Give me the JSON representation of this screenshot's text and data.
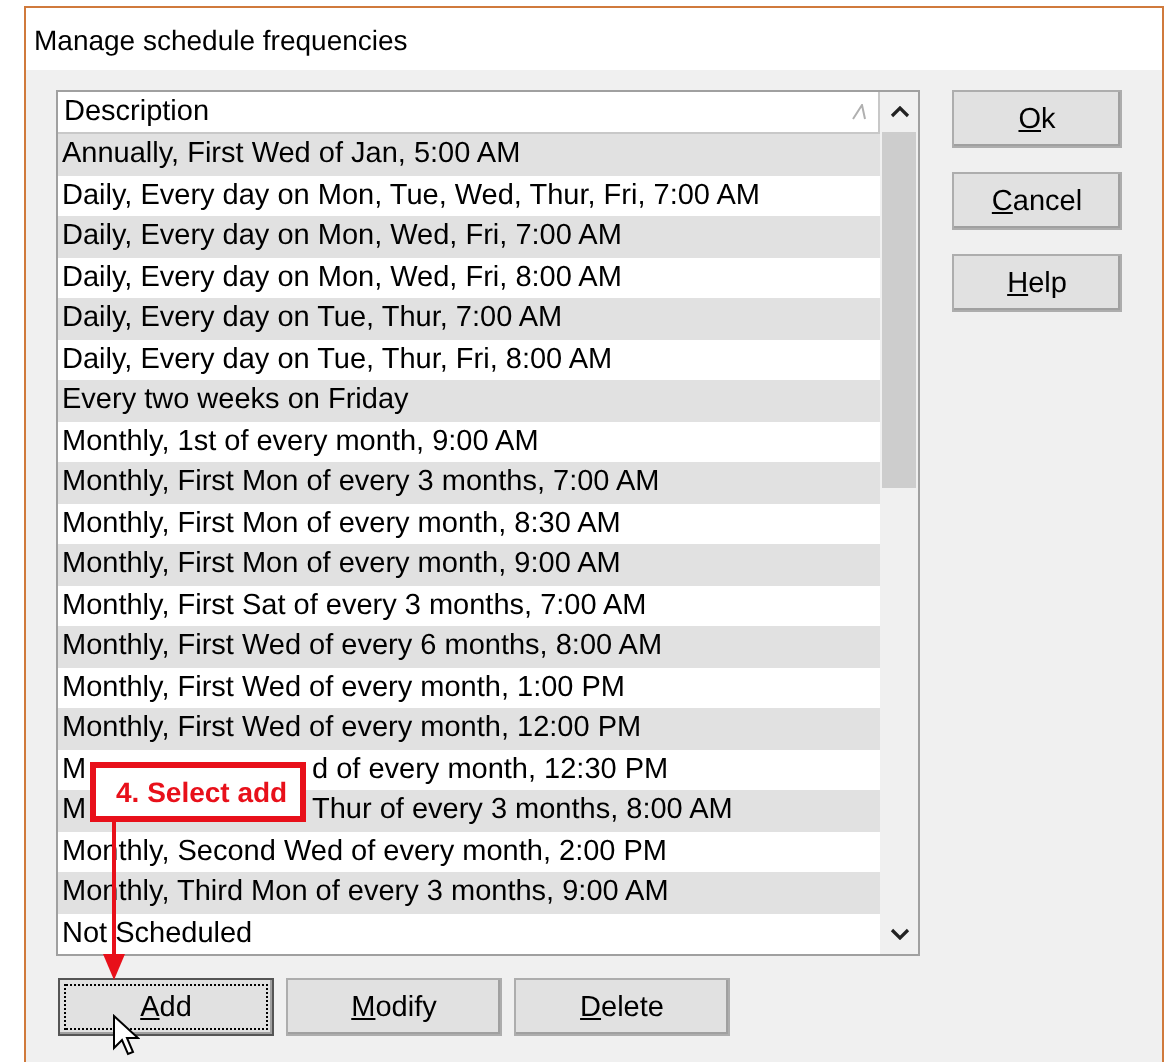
{
  "window": {
    "title": "Manage schedule frequencies"
  },
  "list": {
    "header": "Description",
    "rows": [
      {
        "parts": [
          "Annually, First Wed of Jan, 5:00 AM"
        ]
      },
      {
        "parts": [
          "Daily, Every day on Mon, Tue, Wed, Thur, Fri, 7:00 AM"
        ]
      },
      {
        "parts": [
          "Daily, Every day on Mon, Wed, Fri, 7:00 AM"
        ]
      },
      {
        "parts": [
          "Daily, Every day on Mon, Wed, Fri, 8:00 AM"
        ]
      },
      {
        "parts": [
          "Daily, Every day on Tue, Thur, 7:00 AM"
        ]
      },
      {
        "parts": [
          "Daily, Every day on Tue, Thur, Fri, 8:00 AM"
        ]
      },
      {
        "parts": [
          "Every two weeks on Friday"
        ]
      },
      {
        "parts": [
          "Monthly, 1st of every month, 9:00 AM"
        ]
      },
      {
        "parts": [
          "Monthly, First Mon of every 3 months, 7:00 AM"
        ]
      },
      {
        "parts": [
          "Monthly, First Mon of every month, 8:30 AM"
        ]
      },
      {
        "parts": [
          "Monthly, First Mon of every month, 9:00 AM"
        ]
      },
      {
        "parts": [
          "Monthly, First Sat of every 3 months, 7:00 AM"
        ]
      },
      {
        "parts": [
          "Monthly, First Wed of every 6 months, 8:00 AM"
        ]
      },
      {
        "parts": [
          "Monthly, First Wed of every month, 1:00 PM"
        ]
      },
      {
        "parts": [
          "Monthly, First Wed of every month, 12:00 PM"
        ]
      },
      {
        "parts": [
          "M",
          "d of every month, 12:30 PM"
        ]
      },
      {
        "parts": [
          "M",
          "Thur of every 3 months, 8:00 AM"
        ]
      },
      {
        "parts": [
          "Monthly, Second Wed of every month, 2:00 PM"
        ]
      },
      {
        "parts": [
          "Monthly, Third Mon of every 3 months, 9:00 AM"
        ]
      },
      {
        "parts": [
          "Not Scheduled"
        ]
      }
    ]
  },
  "side_buttons": [
    {
      "label": "Ok"
    },
    {
      "label": "Cancel"
    },
    {
      "label": "Help"
    }
  ],
  "bottom_buttons": [
    {
      "label": "Add",
      "focused": true
    },
    {
      "label": "Modify",
      "focused": false
    },
    {
      "label": "Delete",
      "focused": false
    }
  ],
  "callout": {
    "text": "4. Select add"
  }
}
